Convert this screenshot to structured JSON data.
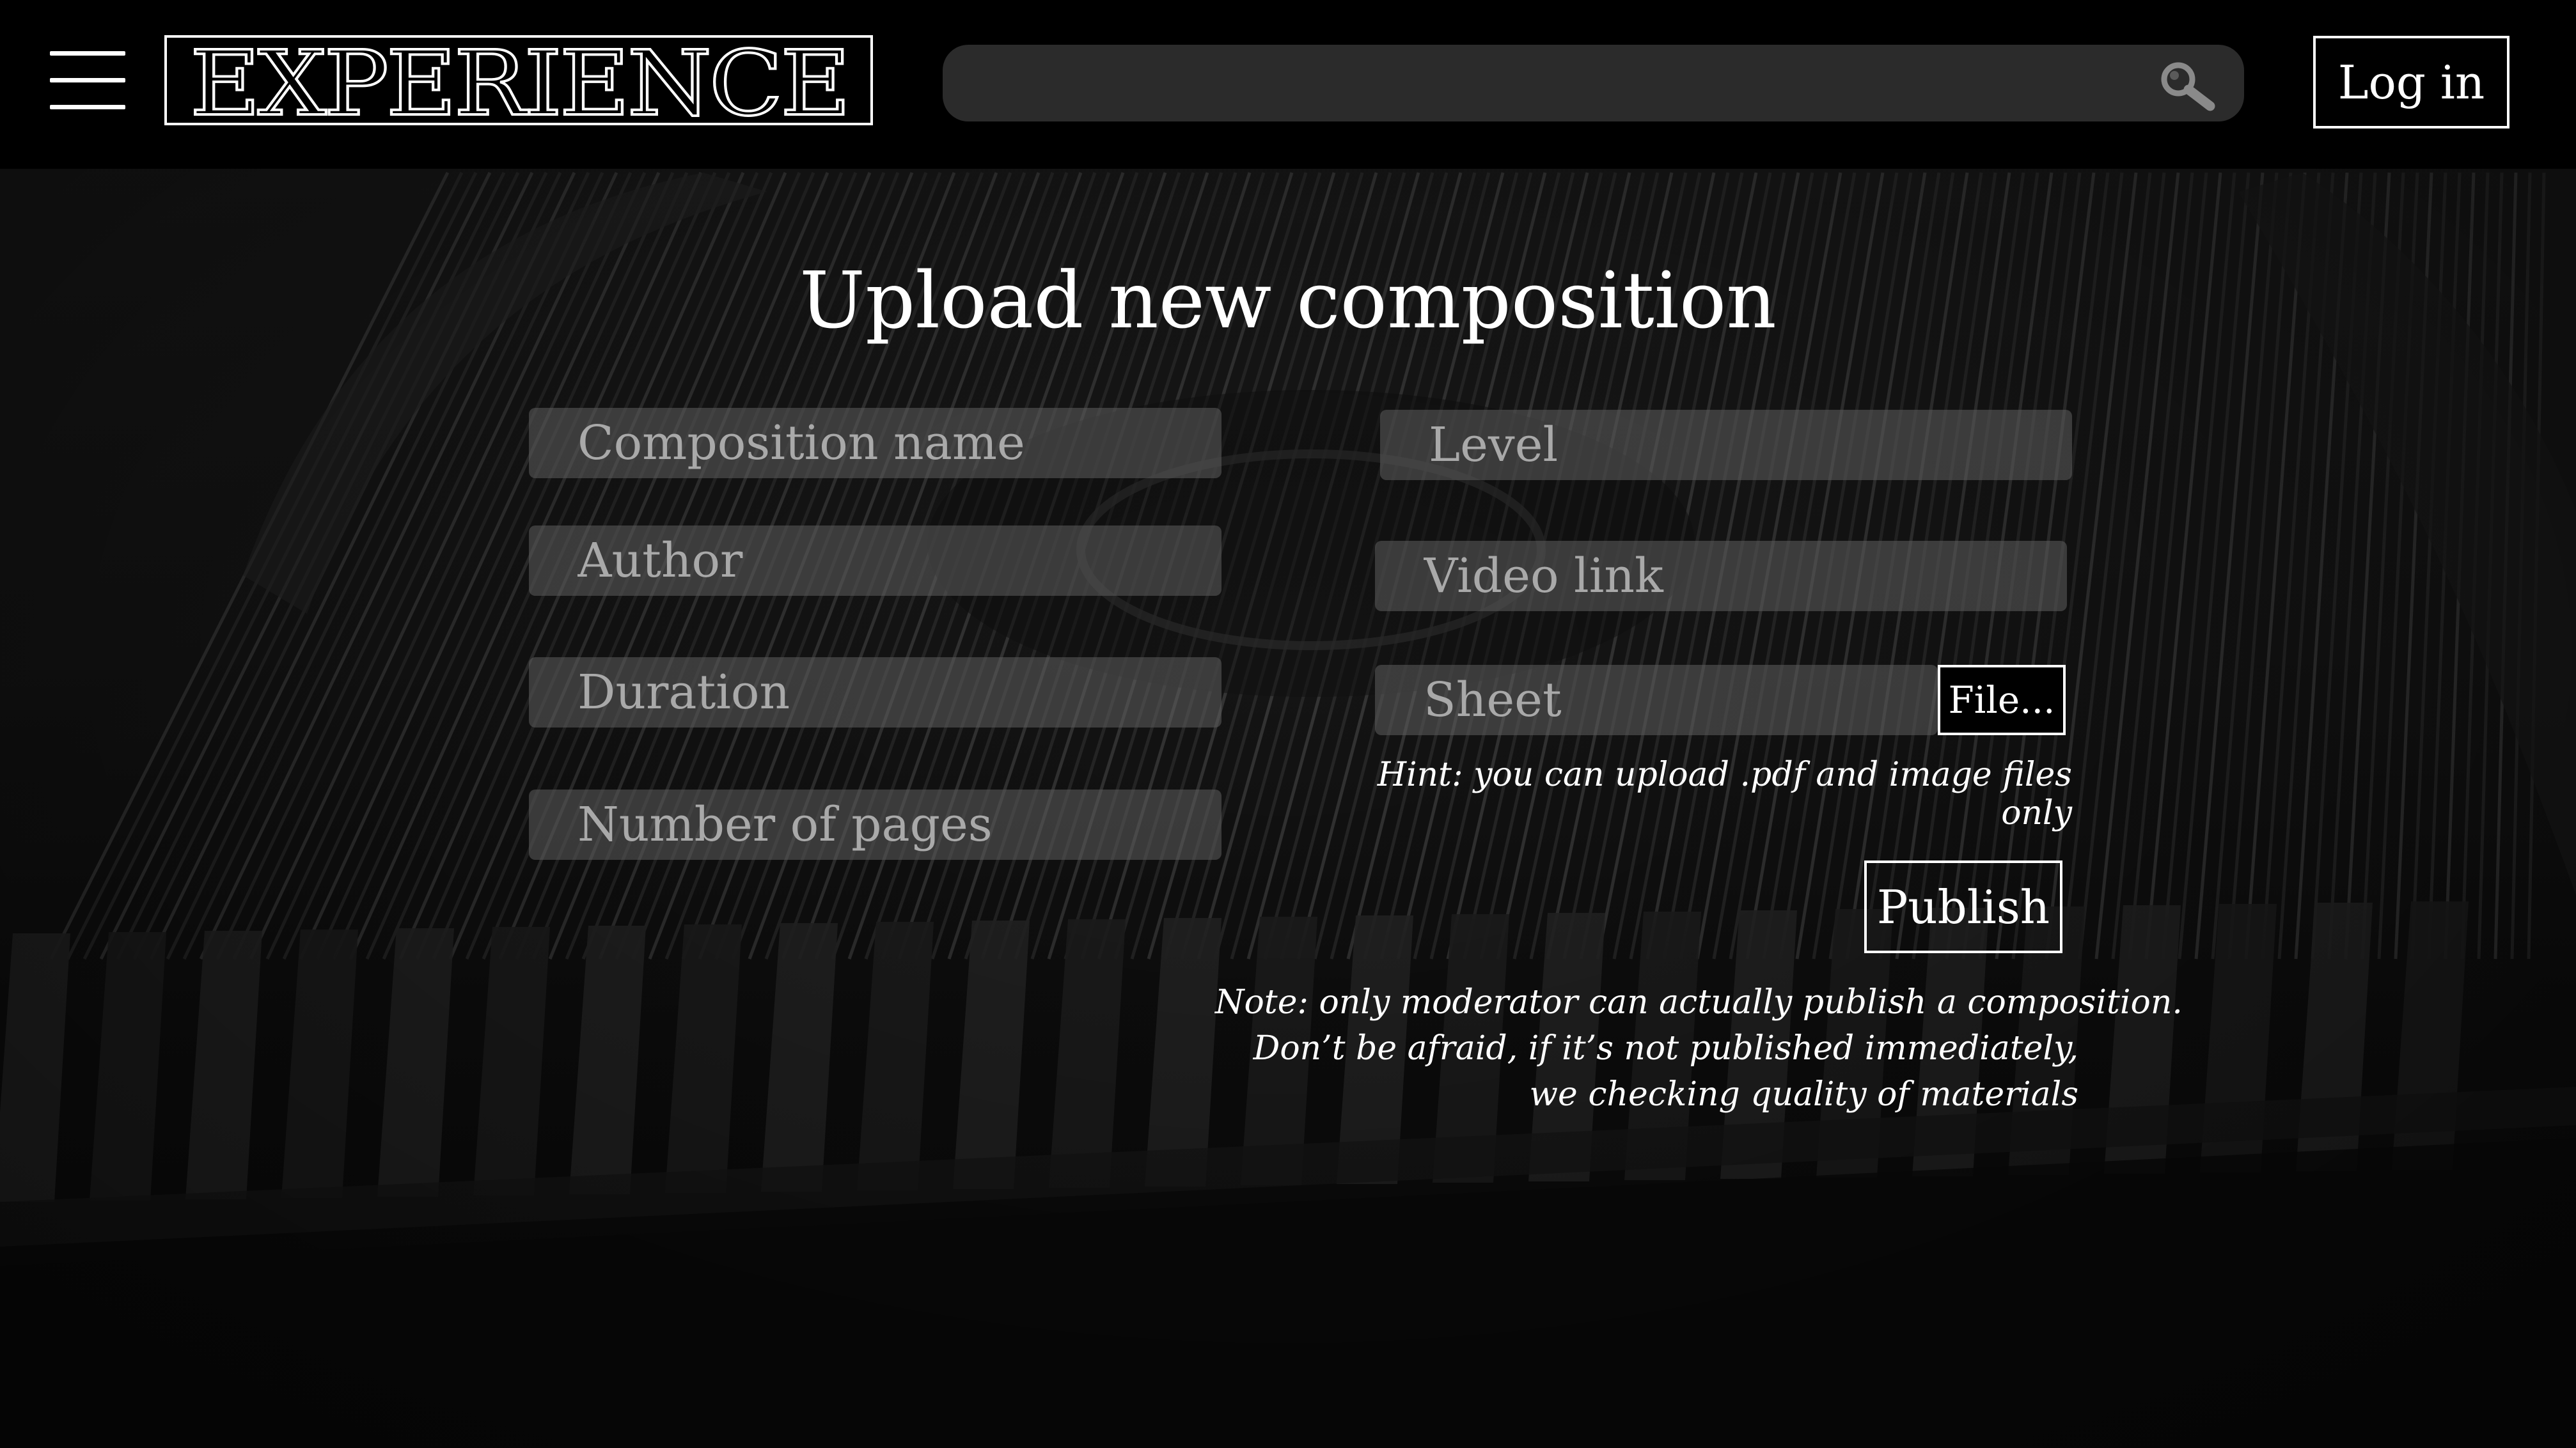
{
  "header": {
    "logo": "EXPERIENCE",
    "search": {
      "value": "",
      "placeholder": ""
    },
    "login_label": "Log in"
  },
  "form": {
    "title": "Upload new composition",
    "fields": {
      "composition_name": "Composition name",
      "author": "Author",
      "duration": "Duration",
      "number_of_pages": "Number of pages",
      "level": "Level",
      "video_link": "Video link",
      "sheet": "Sheet"
    },
    "file_button_label": "File...",
    "hint": "Hint: you can upload .pdf and image files only",
    "publish_label": "Publish",
    "note": [
      "Note: only moderator can actually publish a composition.",
      "Don’t be afraid, if it’s not published immediately,",
      "we checking quality of materials"
    ]
  },
  "icons": {
    "menu": "hamburger-menu-icon",
    "search": "search-icon"
  },
  "colors": {
    "header_bg": "#000000",
    "search_bg": "#2b2b2b",
    "field_bg": "#5f5f5f",
    "text": "#ffffff",
    "placeholder": "#a9a9a9"
  }
}
